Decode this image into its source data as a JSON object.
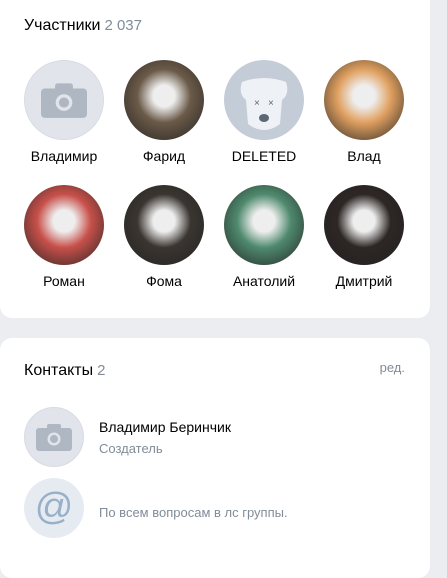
{
  "members": {
    "title": "Участники",
    "count": "2 037",
    "items": [
      {
        "name": "Владимир",
        "avatar": "camera-placeholder"
      },
      {
        "name": "Фарид",
        "avatar": "photo",
        "color": "#6b5a48"
      },
      {
        "name": "DELETED",
        "avatar": "deleted-dog"
      },
      {
        "name": "Влад",
        "avatar": "photo",
        "color": "#e0a060"
      },
      {
        "name": "Роман",
        "avatar": "photo",
        "color": "#c8504a"
      },
      {
        "name": "Фома",
        "avatar": "photo",
        "color": "#3a3530"
      },
      {
        "name": "Анатолий",
        "avatar": "photo",
        "color": "#4f8a6e"
      },
      {
        "name": "Дмитрий",
        "avatar": "photo",
        "color": "#2d2624"
      }
    ]
  },
  "contacts": {
    "title": "Контакты",
    "count": "2",
    "edit_label": "ред.",
    "items": [
      {
        "name": "Владимир Беринчик",
        "role": "Создатель",
        "icon": "camera-placeholder"
      },
      {
        "text": "По всем вопросам в лс группы.",
        "icon": "at-sign"
      }
    ]
  }
}
